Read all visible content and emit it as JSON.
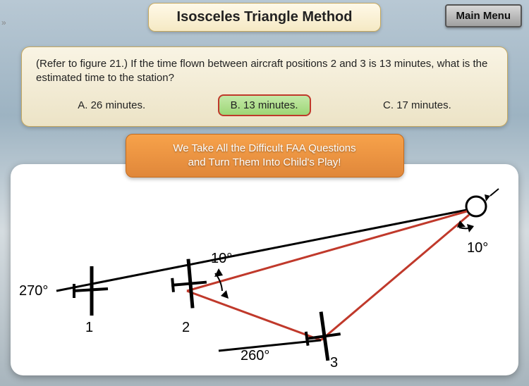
{
  "header": {
    "title": "Isosceles Triangle Method",
    "main_menu": "Main Menu"
  },
  "question": {
    "prompt": "(Refer to figure 21.) If the time flown between aircraft positions 2 and 3 is 13 minutes, what is the estimated time to the station?",
    "answers": {
      "a": "A.  26 minutes.",
      "b": "B.  13 minutes.",
      "c": "C.  17 minutes."
    }
  },
  "promo": {
    "line1": "We Take All the Difficult FAA Questions",
    "line2": "and Turn Them Into Child's Play!"
  },
  "figure": {
    "labels": {
      "heading_left": "270°",
      "heading_mid": "260°",
      "angle_top": "10°",
      "angle_right": "10°",
      "pos1": "1",
      "pos2": "2",
      "pos3": "3"
    }
  },
  "nav": {
    "handle": "»"
  }
}
